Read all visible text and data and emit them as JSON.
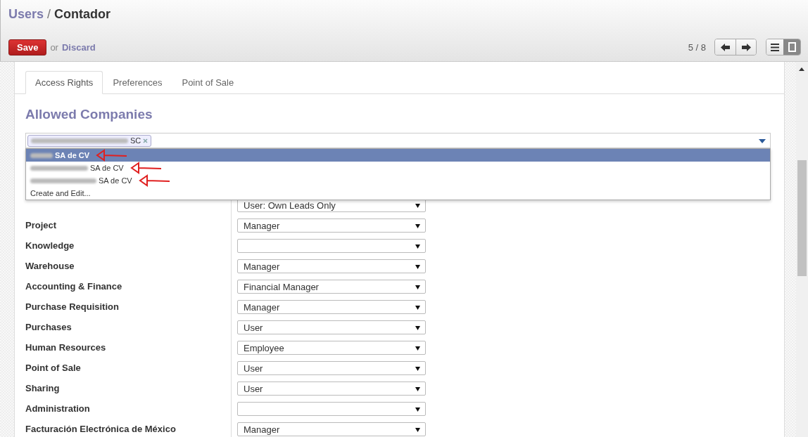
{
  "breadcrumb": {
    "parent": "Users",
    "separator": "/",
    "current": "Contador"
  },
  "actions": {
    "save": "Save",
    "or": "or",
    "discard": "Discard"
  },
  "pager": {
    "text": "5 / 8"
  },
  "views": [
    {
      "kind": "list",
      "selected": false
    },
    {
      "kind": "form",
      "selected": true
    }
  ],
  "tabs": [
    {
      "label": "Access Rights",
      "selected": true
    },
    {
      "label": "Preferences",
      "selected": false
    },
    {
      "label": "Point of Sale",
      "selected": false
    }
  ],
  "section_title": "Allowed Companies",
  "companies_field": {
    "tags": [
      {
        "blurred": true,
        "label": "SC"
      }
    ]
  },
  "dropdown": {
    "options": [
      {
        "blurred": true,
        "label": "SA de CV",
        "selected": true,
        "annotated": true
      },
      {
        "blurred": true,
        "label": "SA de CV",
        "selected": false,
        "annotated": true
      },
      {
        "blurred": true,
        "label": "SA de CV",
        "selected": false,
        "annotated": true
      }
    ],
    "create_label": "Create and Edit..."
  },
  "access_rows": [
    {
      "value": "User: Own Leads Only"
    },
    {
      "label": "Project",
      "value": "Manager"
    },
    {
      "label": "Knowledge"
    },
    {
      "label": "Warehouse",
      "value": "Manager"
    },
    {
      "label": "Accounting & Finance",
      "value": "Financial Manager"
    },
    {
      "label": "Purchase Requisition",
      "value": "Manager"
    },
    {
      "label": "Purchases",
      "value": "User"
    },
    {
      "label": "Human Resources",
      "value": "Employee"
    },
    {
      "label": "Point of Sale",
      "value": "User"
    },
    {
      "label": "Sharing",
      "value": "User"
    },
    {
      "label": "Administration"
    },
    {
      "label": "Facturación Electrónica de México",
      "value": "Manager"
    }
  ]
}
